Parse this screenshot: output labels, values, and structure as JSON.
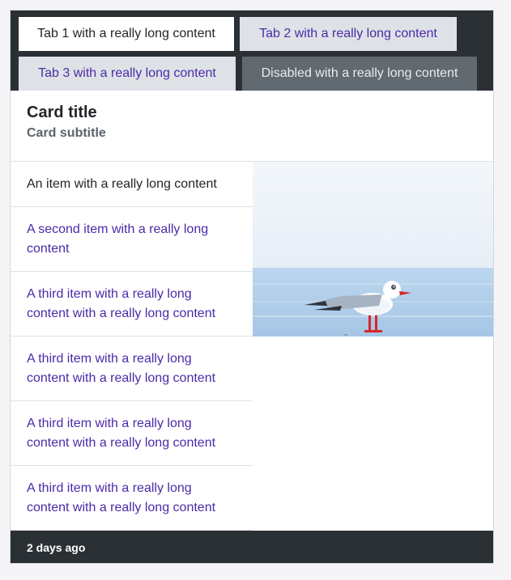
{
  "tabs": {
    "tab1": "Tab 1 with a really long content",
    "tab2": "Tab 2 with a really long content",
    "tab3": "Tab 3 with a really long content",
    "disabled": "Disabled with a really long content"
  },
  "card": {
    "title": "Card title",
    "subtitle": "Card subtitle"
  },
  "list": {
    "items": [
      "An item with a really long content",
      "A second item with a really long content",
      "A third item with a really long content with a really long content",
      "A third item with a really long content with a really long content",
      "A third item with a really long content with a really long content",
      "A third item with a really long content with a really long content"
    ]
  },
  "footer": {
    "text": "2 days ago"
  },
  "colors": {
    "tabbar_bg": "#2b3035",
    "link": "#4b2aa8",
    "footer_bg": "#2b3035"
  }
}
